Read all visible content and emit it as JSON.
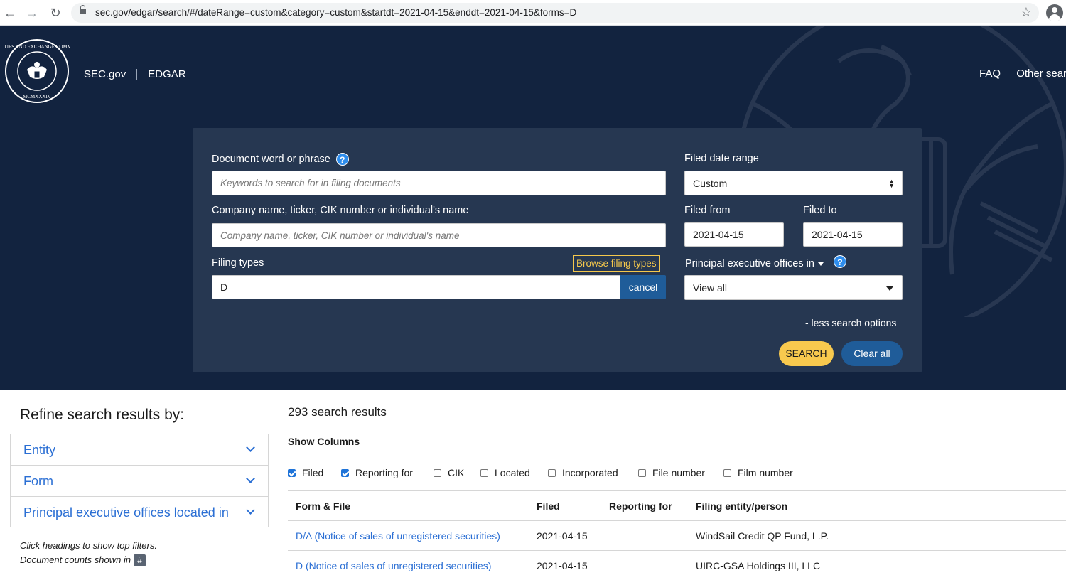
{
  "browser": {
    "url": "sec.gov/edgar/search/#/dateRange=custom&category=custom&startdt=2021-04-15&enddt=2021-04-15&forms=D"
  },
  "header": {
    "seal_text": "SECURITIES AND EXCHANGE COMMISSION",
    "seal_year": "MCMXXXIV",
    "site": "SEC.gov",
    "section": "EDGAR",
    "nav_faq": "FAQ",
    "nav_other": "Other searc"
  },
  "search": {
    "doc_label": "Document word or phrase",
    "doc_placeholder": "Keywords to search for in filing documents",
    "company_label": "Company name, ticker, CIK number or individual's name",
    "company_placeholder": "Company name, ticker, CIK number or individual's name",
    "filing_label": "Filing types",
    "browse_label": "Browse filing types",
    "filing_value": "D",
    "cancel_label": "cancel",
    "date_range_label": "Filed date range",
    "date_range_value": "Custom",
    "filed_from_label": "Filed from",
    "filed_from_value": "2021-04-15",
    "filed_to_label": "Filed to",
    "filed_to_value": "2021-04-15",
    "peo_label": "Principal executive offices in",
    "peo_value": "View all",
    "less_options": "- less search options",
    "search_button": "SEARCH",
    "clear_button": "Clear all",
    "help_glyph": "?"
  },
  "refine": {
    "title": "Refine search results by:",
    "facets": [
      "Entity",
      "Form",
      "Principal executive offices located in"
    ],
    "hint1": "Click headings to show top filters.",
    "hint2": "Document counts shown in",
    "hash": "#"
  },
  "results": {
    "count": "293 search results",
    "show_columns": "Show Columns",
    "column_options": [
      {
        "label": "Filed",
        "checked": true
      },
      {
        "label": "Reporting for",
        "checked": true
      },
      {
        "label": "CIK",
        "checked": false
      },
      {
        "label": "Located",
        "checked": false
      },
      {
        "label": "Incorporated",
        "checked": false
      },
      {
        "label": "File number",
        "checked": false
      },
      {
        "label": "Film number",
        "checked": false
      }
    ],
    "headers": [
      "Form & File",
      "Filed",
      "Reporting for",
      "Filing entity/person"
    ],
    "rows": [
      {
        "form": "D/A (Notice of sales of unregistered securities)",
        "filed": "2021-04-15",
        "reporting_for": "",
        "entity": "WindSail Credit QP Fund, L.P."
      },
      {
        "form": "D (Notice of sales of unregistered securities)",
        "filed": "2021-04-15",
        "reporting_for": "",
        "entity": "UIRC-GSA Holdings III, LLC"
      }
    ]
  },
  "colors": {
    "hero_bg": "#12233f",
    "panel_bg": "#263751",
    "accent_yellow": "#f8c94e",
    "accent_blue": "#1f5c99",
    "link_blue": "#2b6fd4"
  }
}
